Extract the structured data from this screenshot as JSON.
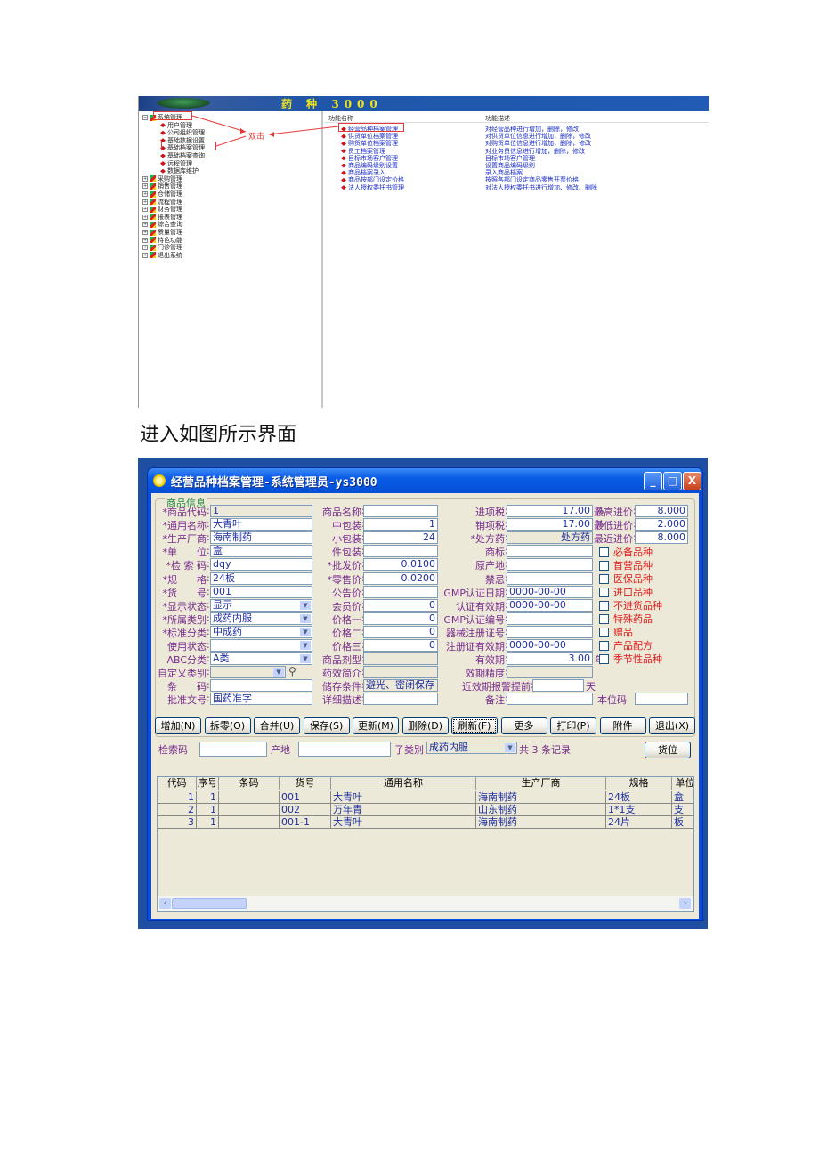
{
  "screenshot1": {
    "banner_title": "药 种 3000",
    "tree": [
      {
        "label": "系统管理",
        "expanded": true,
        "children": [
          "用户管理",
          "公司组织管理",
          "基础数据设置",
          "基础档案管理",
          "基础档案查询",
          "远程管理",
          "数据库维护"
        ]
      },
      {
        "label": "采购管理"
      },
      {
        "label": "销售管理"
      },
      {
        "label": "仓储管理"
      },
      {
        "label": "流程管理"
      },
      {
        "label": "财务管理"
      },
      {
        "label": "报表管理"
      },
      {
        "label": "综合查询"
      },
      {
        "label": "质量管理"
      },
      {
        "label": "特色功能"
      },
      {
        "label": "门诊管理"
      },
      {
        "label": "退出系统"
      }
    ],
    "annotation": "双击",
    "function_pane": {
      "headers": [
        "功能名称",
        "功能描述"
      ],
      "rows": [
        {
          "name": "经营品种档案管理",
          "desc": "对经营品种进行增加，删除，修改"
        },
        {
          "name": "供货单位档案管理",
          "desc": "对供货单位信息进行增加，删除，修改"
        },
        {
          "name": "购货单位档案管理",
          "desc": "对购货单位信息进行增加，删除，修改"
        },
        {
          "name": "员工档案管理",
          "desc": "对业务员信息进行增加，删除，修改"
        },
        {
          "name": "目标市场客户管理",
          "desc": "目标市场客户管理"
        },
        {
          "name": "商品编码级别设置",
          "desc": "设置商品编码级别"
        },
        {
          "name": "商品档案录入",
          "desc": "录入商品档案"
        },
        {
          "name": "商品按部门设定价格",
          "desc": "按照各部门设定商品零售开票价格"
        },
        {
          "name": "法人授权委托书管理",
          "desc": "对法人授权委托书进行增加、修改、删除"
        }
      ]
    }
  },
  "caption": "进入如图所示界面",
  "window": {
    "title": "经营品种档案管理-系统管理员-ys3000",
    "controls": {
      "minimize": "_",
      "maximize": "□",
      "close": "X"
    },
    "group_label": "商品信息",
    "col1": [
      {
        "label": "商品代码",
        "required": true,
        "value": "1",
        "readonly": true
      },
      {
        "label": "通用名称",
        "required": true,
        "value": "大青叶"
      },
      {
        "label": "生产厂商",
        "required": true,
        "value": "海南制药"
      },
      {
        "label": "单　　位",
        "required": true,
        "value": "盒"
      },
      {
        "label": "检 索 码",
        "required": true,
        "value": "dqy"
      },
      {
        "label": "规　　格",
        "required": true,
        "value": "24板"
      },
      {
        "label": "货　　号",
        "required": true,
        "value": "001"
      },
      {
        "label": "显示状态",
        "required": true,
        "value": "显示",
        "select": true
      },
      {
        "label": "所属类别",
        "required": true,
        "value": "成药内服",
        "select": true
      },
      {
        "label": "标准分类",
        "required": true,
        "value": "中成药",
        "select": true
      },
      {
        "label": "使用状态",
        "value": "",
        "select": true
      },
      {
        "label": "ABC分类",
        "value": "A类",
        "select": true
      },
      {
        "label": "自定义类别",
        "value": "",
        "select": true,
        "readonly": true
      },
      {
        "label": "条　　码",
        "value": ""
      },
      {
        "label": "批准文号",
        "value": "国药准字"
      }
    ],
    "col2": [
      {
        "label": "商品名称",
        "value": ""
      },
      {
        "label": "中包装",
        "value": "1"
      },
      {
        "label": "小包装",
        "value": "24"
      },
      {
        "label": "件包装",
        "value": ""
      },
      {
        "label": "批发价",
        "required": true,
        "value": "0.0100"
      },
      {
        "label": "零售价",
        "required": true,
        "value": "0.0200"
      },
      {
        "label": "公告价",
        "value": ""
      },
      {
        "label": "会员价",
        "value": "0"
      },
      {
        "label": "价格一",
        "value": "0"
      },
      {
        "label": "价格二",
        "value": "0"
      },
      {
        "label": "价格三",
        "value": "0"
      },
      {
        "label": "商品剂型",
        "value": "",
        "readonly": true
      },
      {
        "label": "药效简介",
        "value": "",
        "readonly": true
      },
      {
        "label": "储存条件",
        "value": "避光、密闭保存",
        "readonly": true
      },
      {
        "label": "详细描述",
        "value": ""
      }
    ],
    "col3": [
      {
        "label": "进项税",
        "value": "17.00",
        "suffix": "%"
      },
      {
        "label": "销项税",
        "value": "17.00",
        "suffix": "%"
      },
      {
        "label": "处方药",
        "required": true,
        "value": "处方药",
        "readonly": true
      },
      {
        "label": "商标",
        "value": ""
      },
      {
        "label": "原产地",
        "value": ""
      },
      {
        "label": "禁忌",
        "value": ""
      },
      {
        "label": "GMP认证日期",
        "value": "0000-00-00"
      },
      {
        "label": "认证有效期",
        "value": "0000-00-00"
      },
      {
        "label": "GMP认证编号",
        "value": ""
      },
      {
        "label": "器械注册证号",
        "value": ""
      },
      {
        "label": "注册证有效期",
        "value": "0000-00-00"
      },
      {
        "label": "有效期",
        "value": "3.00",
        "suffix": "年"
      },
      {
        "label": "效期精度",
        "value": "",
        "readonly": true
      },
      {
        "label": "近效期报警提前",
        "value": "",
        "suffix": "天"
      },
      {
        "label": "备注",
        "value": ""
      }
    ],
    "col4": [
      {
        "label": "最高进价",
        "value": "8.000"
      },
      {
        "label": "最低进价",
        "value": "2.000"
      },
      {
        "label": "最近进价",
        "value": "8.000"
      }
    ],
    "location_code": {
      "label": "本位码",
      "value": ""
    },
    "checkboxes": [
      {
        "label": "必备品种",
        "checked": false
      },
      {
        "label": "首营品种",
        "checked": false
      },
      {
        "label": "医保品种",
        "checked": false
      },
      {
        "label": "进口品种",
        "checked": false
      },
      {
        "label": "不进货品种",
        "checked": false
      },
      {
        "label": "特殊药品",
        "checked": false
      },
      {
        "label": "赠品",
        "checked": false
      },
      {
        "label": "产品配方",
        "checked": false
      },
      {
        "label": "季节性品种",
        "checked": false
      }
    ],
    "buttons": [
      "增加(N)",
      "拆零(O)",
      "合并(U)",
      "保存(S)",
      "更新(M)",
      "删除(D)",
      "刷新(F)",
      "更多",
      "打印(P)",
      "附件",
      "退出(X)"
    ],
    "filter": {
      "search_label": "检索码",
      "search_value": "",
      "origin_label": "产地",
      "origin_value": "",
      "subcat_label": "子类别",
      "subcat_value": "成药内服",
      "record_count": "共 3 条记录",
      "locate_button": "货位"
    },
    "grid": {
      "columns": [
        "代码",
        "序号",
        "条码",
        "货号",
        "通用名称",
        "生产厂商",
        "规格",
        "单位"
      ],
      "rows": [
        [
          "1",
          "1",
          "",
          "001",
          "大青叶",
          "海南制药",
          "24板",
          "盒"
        ],
        [
          "2",
          "1",
          "",
          "002",
          "万年青",
          "山东制药",
          "1*1支",
          "支"
        ],
        [
          "3",
          "1",
          "",
          "001-1",
          "大青叶",
          "海南制药",
          "24片",
          "板"
        ]
      ]
    }
  }
}
